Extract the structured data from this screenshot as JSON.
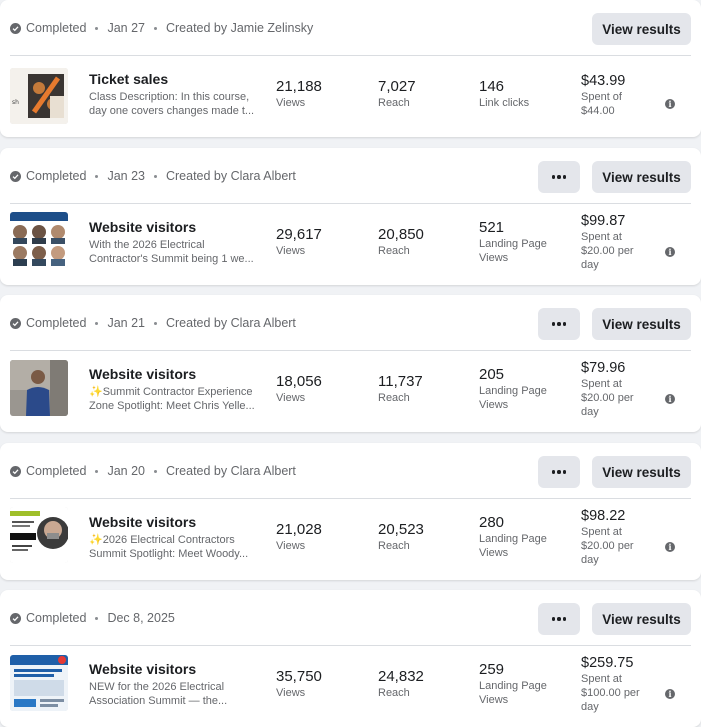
{
  "actions": {
    "view_results_label": "View results"
  },
  "cards": [
    {
      "status": "Completed",
      "date": "Jan 27",
      "created_by": "Created by Jamie Zelinsky",
      "has_more_button": false,
      "ad": {
        "title": "Ticket sales",
        "description_lines": [
          "Class Description: In this course,",
          "day one covers changes made t..."
        ]
      },
      "views": {
        "value": "21,188",
        "label": "Views"
      },
      "reach": {
        "value": "7,027",
        "label": "Reach"
      },
      "result": {
        "value": "146",
        "label_lines": [
          "Link clicks"
        ]
      },
      "spend": {
        "value": "$43.99",
        "label_lines": [
          "Spent of",
          "$44.00"
        ]
      }
    },
    {
      "status": "Completed",
      "date": "Jan 23",
      "created_by": "Created by Clara Albert",
      "has_more_button": true,
      "ad": {
        "title": "Website visitors",
        "description_lines": [
          "With the 2026 Electrical",
          "Contractor's Summit being 1 we..."
        ]
      },
      "views": {
        "value": "29,617",
        "label": "Views"
      },
      "reach": {
        "value": "20,850",
        "label": "Reach"
      },
      "result": {
        "value": "521",
        "label_lines": [
          "Landing Page",
          "Views"
        ]
      },
      "spend": {
        "value": "$99.87",
        "label_lines": [
          "Spent at",
          "$20.00 per",
          "day"
        ]
      }
    },
    {
      "status": "Completed",
      "date": "Jan 21",
      "created_by": "Created by Clara Albert",
      "has_more_button": true,
      "ad": {
        "title": "Website visitors",
        "description_lines": [
          "✨Summit Contractor Experience",
          "Zone Spotlight: Meet Chris Yelle..."
        ]
      },
      "views": {
        "value": "18,056",
        "label": "Views"
      },
      "reach": {
        "value": "11,737",
        "label": "Reach"
      },
      "result": {
        "value": "205",
        "label_lines": [
          "Landing Page",
          "Views"
        ]
      },
      "spend": {
        "value": "$79.96",
        "label_lines": [
          "Spent at",
          "$20.00 per",
          "day"
        ]
      }
    },
    {
      "status": "Completed",
      "date": "Jan 20",
      "created_by": "Created by Clara Albert",
      "has_more_button": true,
      "ad": {
        "title": "Website visitors",
        "description_lines": [
          "✨2026 Electrical Contractors",
          "Summit Spotlight: Meet Woody..."
        ]
      },
      "views": {
        "value": "21,028",
        "label": "Views"
      },
      "reach": {
        "value": "20,523",
        "label": "Reach"
      },
      "result": {
        "value": "280",
        "label_lines": [
          "Landing Page",
          "Views"
        ]
      },
      "spend": {
        "value": "$98.22",
        "label_lines": [
          "Spent at",
          "$20.00 per",
          "day"
        ]
      }
    },
    {
      "status": "Completed",
      "date": "Dec 8, 2025",
      "created_by": "",
      "has_more_button": true,
      "ad": {
        "title": "Website visitors",
        "description_lines": [
          "NEW for the 2026 Electrical",
          "Association Summit — the..."
        ]
      },
      "views": {
        "value": "35,750",
        "label": "Views"
      },
      "reach": {
        "value": "24,832",
        "label": "Reach"
      },
      "result": {
        "value": "259",
        "label_lines": [
          "Landing Page",
          "Views"
        ]
      },
      "spend": {
        "value": "$259.75",
        "label_lines": [
          "Spent at",
          "$100.00 per",
          "day"
        ]
      }
    }
  ]
}
